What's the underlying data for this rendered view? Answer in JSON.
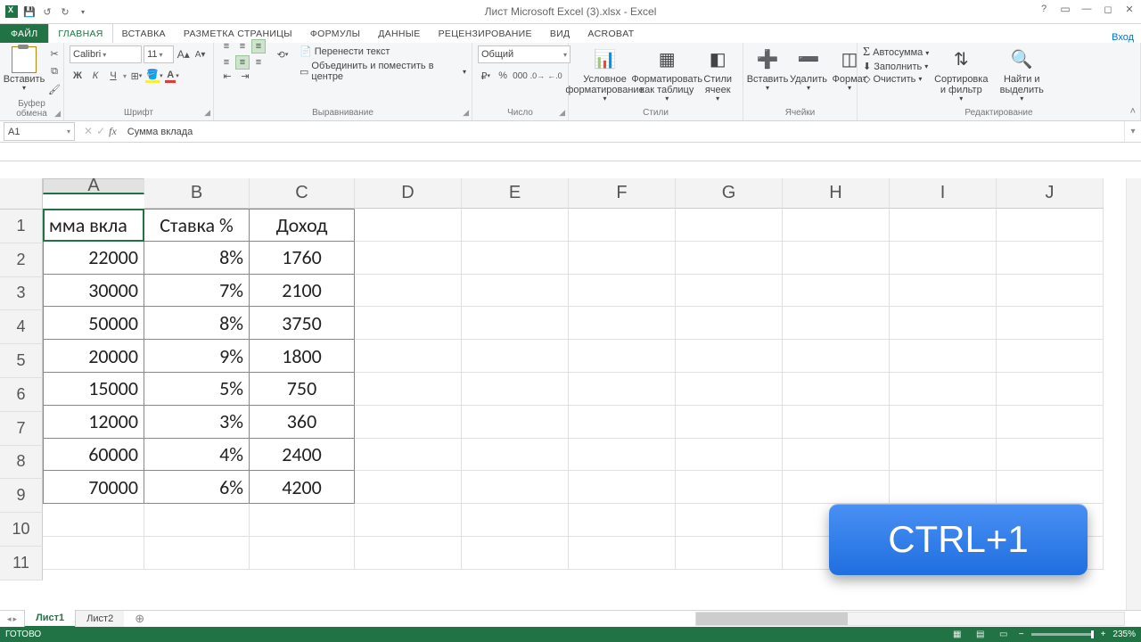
{
  "title": "Лист Microsoft Excel (3).xlsx - Excel",
  "signin": "Вход",
  "tabs": {
    "file": "ФАЙЛ",
    "home": "ГЛАВНАЯ",
    "insert": "ВСТАВКА",
    "layout": "РАЗМЕТКА СТРАНИЦЫ",
    "formulas": "ФОРМУЛЫ",
    "data": "ДАННЫЕ",
    "review": "РЕЦЕНЗИРОВАНИЕ",
    "view": "ВИД",
    "acrobat": "ACROBAT"
  },
  "groups": {
    "clipboard": "Буфер обмена",
    "font": "Шрифт",
    "align": "Выравнивание",
    "number": "Число",
    "styles": "Стили",
    "cells": "Ячейки",
    "editing": "Редактирование"
  },
  "ribbon": {
    "paste": "Вставить",
    "font_name": "Calibri",
    "font_size": "11",
    "wrap": "Перенести текст",
    "merge": "Объединить и поместить в центре",
    "number_format": "Общий",
    "cond": "Условное форматирование",
    "fmttable": "Форматировать как таблицу",
    "cellstyles": "Стили ячеек",
    "ins": "Вставить",
    "del": "Удалить",
    "fmt": "Формат",
    "autosum": "Автосумма",
    "fill": "Заполнить",
    "clear": "Очистить",
    "sort": "Сортировка и фильтр",
    "find": "Найти и выделить"
  },
  "font_buttons": {
    "bold": "Ж",
    "italic": "К",
    "underline": "Ч"
  },
  "namebox": "A1",
  "formula": "Сумма вклада",
  "cols": [
    "A",
    "B",
    "C",
    "D",
    "E",
    "F",
    "G",
    "H",
    "I",
    "J"
  ],
  "rows": [
    "1",
    "2",
    "3",
    "4",
    "5",
    "6",
    "7",
    "8",
    "9",
    "10",
    "11"
  ],
  "headers": {
    "A": "мма вкла",
    "B": "Ставка %",
    "C": "Доход"
  },
  "data": [
    {
      "A": "22000",
      "B": "8%",
      "C": "1760"
    },
    {
      "A": "30000",
      "B": "7%",
      "C": "2100"
    },
    {
      "A": "50000",
      "B": "8%",
      "C": "3750"
    },
    {
      "A": "20000",
      "B": "9%",
      "C": "1800"
    },
    {
      "A": "15000",
      "B": "5%",
      "C": "750"
    },
    {
      "A": "12000",
      "B": "3%",
      "C": "360"
    },
    {
      "A": "60000",
      "B": "4%",
      "C": "2400"
    },
    {
      "A": "70000",
      "B": "6%",
      "C": "4200"
    }
  ],
  "sheets": {
    "s1": "Лист1",
    "s2": "Лист2"
  },
  "status": "ГОТОВО",
  "zoom": "235%",
  "overlay": "CTRL+1"
}
